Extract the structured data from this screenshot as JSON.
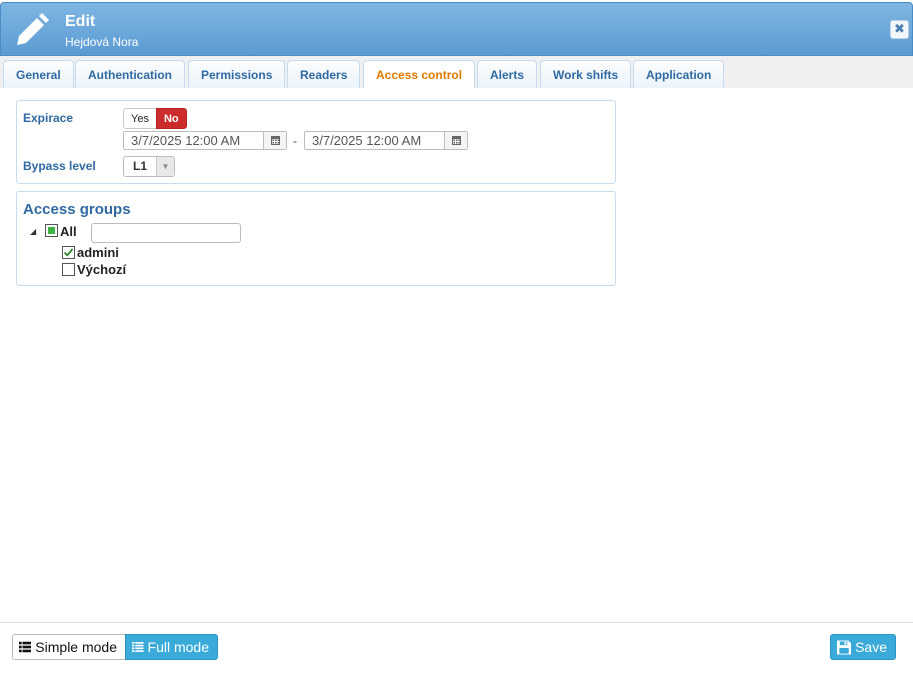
{
  "header": {
    "title": "Edit",
    "subtitle": "Hejdová Nora",
    "close_glyph": "✖",
    "icons": {
      "edit": "pencil-icon",
      "close": "close-icon"
    }
  },
  "tabs": [
    {
      "label": "General",
      "active": false
    },
    {
      "label": "Authentication",
      "active": false
    },
    {
      "label": "Permissions",
      "active": false
    },
    {
      "label": "Readers",
      "active": false
    },
    {
      "label": "Access control",
      "active": true
    },
    {
      "label": "Alerts",
      "active": false
    },
    {
      "label": "Work shifts",
      "active": false
    },
    {
      "label": "Application",
      "active": false
    }
  ],
  "expiration": {
    "label": "Expirace",
    "yes_label": "Yes",
    "no_label": "No",
    "selected": "No",
    "date_from": "3/7/2025 12:00 AM",
    "date_to": "3/7/2025 12:00 AM",
    "separator": "-"
  },
  "bypass": {
    "label": "Bypass level",
    "value": "L1"
  },
  "access_groups": {
    "title": "Access groups",
    "root": {
      "label": "All",
      "state": "partial",
      "expanded": true
    },
    "filter_value": "",
    "children": [
      {
        "label": "admini",
        "checked": true
      },
      {
        "label": "Výchozí",
        "checked": false
      }
    ]
  },
  "footer": {
    "simple_mode_label": "Simple mode",
    "full_mode_label": "Full mode",
    "save_label": "Save",
    "active_mode": "Full mode"
  },
  "colors": {
    "header_accent": "#5b9bd3",
    "tab_active_text": "#e07b00",
    "toggle_no": "#cd2b2b",
    "primary_button": "#3aaad9"
  }
}
